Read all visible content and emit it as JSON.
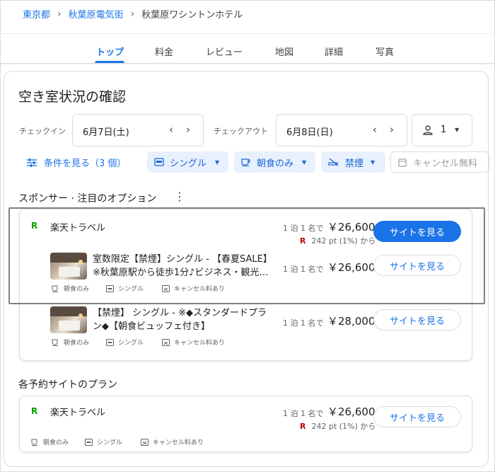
{
  "breadcrumb": {
    "items": [
      "東京都",
      "秋葉原電気街"
    ],
    "current": "秋葉原ワシントンホテル"
  },
  "tabs": [
    "トップ",
    "料金",
    "レビュー",
    "地図",
    "詳細",
    "写真"
  ],
  "availability": {
    "title": "空き室状況の確認",
    "checkin_label": "チェックイン",
    "checkin_value": "6月7日(土)",
    "checkout_label": "チェックアウト",
    "checkout_value": "6月8日(日)",
    "guests": "1"
  },
  "filters": {
    "conditions_link": "条件を見る（3 個）",
    "chips": [
      "シングル",
      "朝食のみ",
      "禁煙"
    ],
    "cancel_chip": "キャンセル無料"
  },
  "sponsor": {
    "section_title": "スポンサー · 注目のオプション",
    "provider_logo": "R",
    "provider_name": "楽天トラベル",
    "per_night_label": "1 泊 1 名で",
    "price": "￥26,600",
    "points_logo": "R",
    "points": "242 pt (1%) から",
    "button": "サイトを見る",
    "rooms": [
      {
        "line1": "室数限定【禁煙】シングル - 【春夏SALE】",
        "line2": "※秋葉原駅から徒歩1分♪ビジネス・観光…",
        "per_night_label": "1 泊 1 名で",
        "price": "￥26,600",
        "button": "サイトを見る",
        "amenities": [
          "朝食のみ",
          "シングル",
          "キャンセル料あり"
        ]
      },
      {
        "line1": "【禁煙】 シングル - ※◆スタンダードプラ",
        "line2": "ン◆【朝食ビュッフェ付き】",
        "per_night_label": "1 泊 1 名で",
        "price": "￥28,000",
        "button": "サイトを見る",
        "amenities": [
          "朝食のみ",
          "シングル",
          "キャンセル料あり"
        ]
      }
    ]
  },
  "plans": {
    "section_title": "各予約サイトのプラン",
    "provider_logo": "R",
    "provider_name": "楽天トラベル",
    "per_night_label": "1 泊 1 名で",
    "price": "￥26,600",
    "points_logo": "R",
    "points": "242 pt (1%) から",
    "button": "サイトを見る",
    "amenities": [
      "朝食のみ",
      "シングル",
      "キャンセル料あり"
    ]
  },
  "colors": {
    "accent": "#1a73e8",
    "chip_bg": "#e8f0fe",
    "rakuten_green": "#0aa000",
    "rakuten_red": "#bf0000"
  }
}
